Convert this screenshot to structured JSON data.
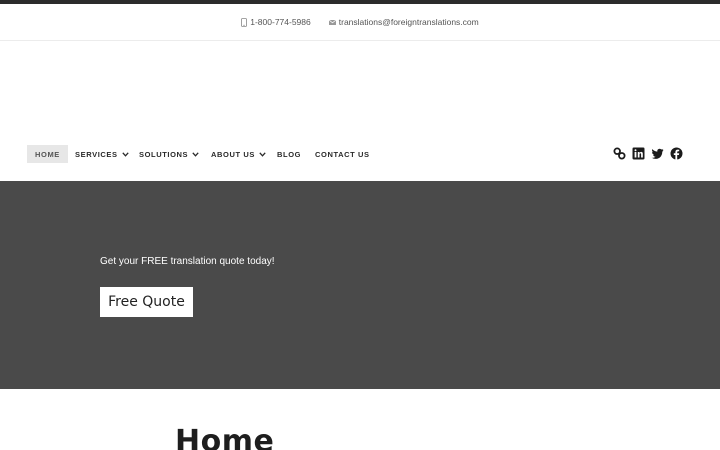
{
  "contact": {
    "phone": "1-800-774-5986",
    "email": "translations@foreigntranslations.com"
  },
  "nav": {
    "items": [
      {
        "label": "HOME",
        "active": true,
        "has_dropdown": false
      },
      {
        "label": "SERVICES",
        "active": false,
        "has_dropdown": true
      },
      {
        "label": "SOLUTIONS",
        "active": false,
        "has_dropdown": true
      },
      {
        "label": "ABOUT US",
        "active": false,
        "has_dropdown": true
      },
      {
        "label": "BLOG",
        "active": false,
        "has_dropdown": false
      },
      {
        "label": "CONTACT US",
        "active": false,
        "has_dropdown": false
      }
    ],
    "social_icons": [
      "link-icon",
      "linkedin-icon",
      "twitter-icon",
      "facebook-icon"
    ]
  },
  "hero": {
    "tagline": "Get your FREE translation quote today!",
    "button_label": "Free Quote"
  },
  "main": {
    "title": "Home"
  },
  "colors": {
    "top_stripe": "#2b2b2b",
    "hero_bg": "#4a4a4a",
    "active_nav_bg": "#e7e7e7"
  }
}
